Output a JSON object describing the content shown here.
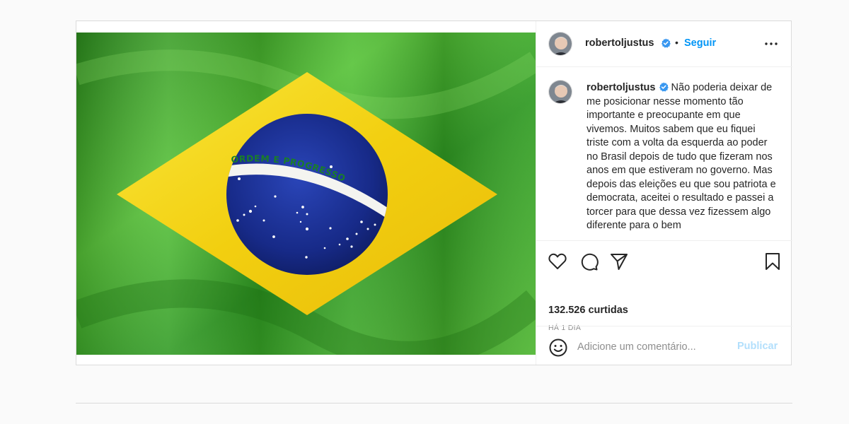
{
  "post": {
    "image_alt": "Bandeira do Brasil",
    "flag_motto": "ORDEM E PROGRESSO",
    "author": "robertoljustus",
    "follow_label": "Seguir",
    "separator": "•",
    "caption_text": "Não poderia deixar de me posicionar nesse momento tão importante e preocupante em que vivemos. Muitos sabem que eu fiquei triste com a volta da esquerda ao poder no Brasil depois de tudo que fizeram nos anos em que estiveram no governo. Mas depois das eleições eu que sou patriota e democrata, aceitei o resultado e passei a torcer para que dessa vez fizessem algo diferente para o bem",
    "likes": "132.526 curtidas",
    "time_ago": "HÁ 1 DIA"
  },
  "comment": {
    "placeholder": "Adicione um comentário...",
    "publish_label": "Publicar"
  },
  "icons": {
    "verified": "verified-badge-icon",
    "more": "more-options-icon",
    "like": "heart-icon",
    "comment": "comment-bubble-icon",
    "share": "paper-plane-icon",
    "save": "bookmark-icon",
    "emoji": "emoji-smile-icon"
  },
  "colors": {
    "link_blue": "#0095f6",
    "publish_disabled": "#b2dffc",
    "verified_blue": "#3897f0",
    "flag_green": "#1fa32a",
    "flag_yellow": "#f6d91a",
    "flag_blue": "#1b2d8f"
  }
}
